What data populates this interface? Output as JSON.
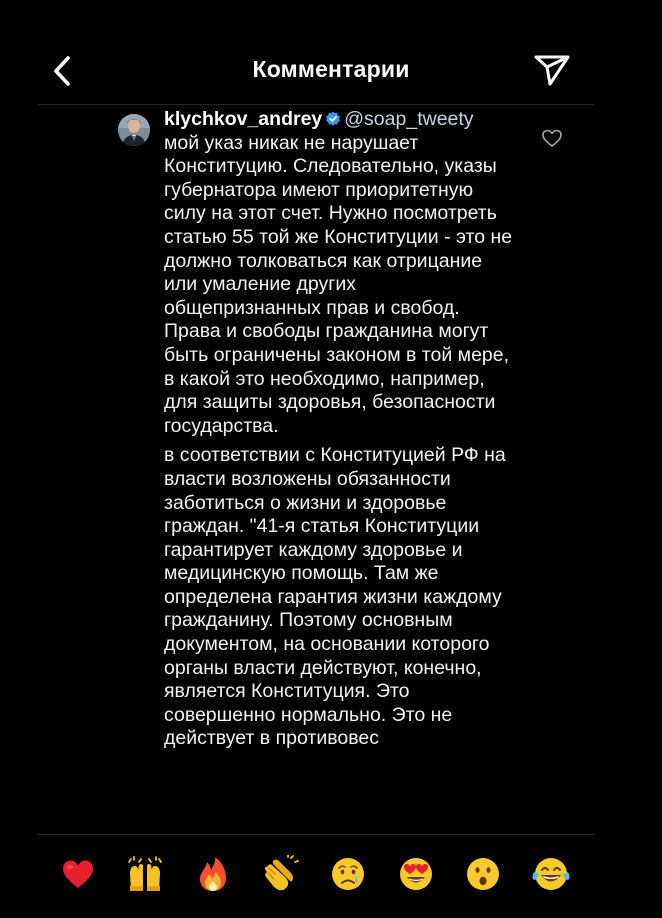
{
  "header": {
    "title": "Комментарии",
    "back_icon": "chevron-left-icon",
    "share_icon": "direct-send-icon"
  },
  "comment": {
    "username": "klychkov_andrey",
    "verified": true,
    "mention": "@soap_tweety",
    "paragraph_1": "мой указ никак не нарушает Конституцию. Следовательно, указы губернатора имеют приоритетную силу на этот счет. Нужно посмотреть статью 55 той же Конституции - это не должно толковаться как отрицание или умаление других общепризнанных прав и свобод. Права и свободы гражданина могут быть ограничены законом в той мере, в какой это необходимо, например, для защиты здоровья, безопасности государства.",
    "paragraph_2": "в соответствии с Конституцией РФ на власти возложены обязанности заботиться о жизни и здоровье граждан. \"41-я статья Конституции гарантирует каждому здоровье и медицинскую помощь. Там же определена гарантия жизни каждому гражданину. Поэтому основным документом, на основании которого органы власти действуют, конечно, является Конституция. Это совершенно нормально. Это не действует в противовес",
    "like_icon": "heart-outline-icon"
  },
  "reactions": [
    {
      "name": "red-heart",
      "emoji": "❤️"
    },
    {
      "name": "raising-hands",
      "emoji": "🙌"
    },
    {
      "name": "fire",
      "emoji": "🔥"
    },
    {
      "name": "clapping-hands",
      "emoji": "👏"
    },
    {
      "name": "crying-face",
      "emoji": "😢"
    },
    {
      "name": "heart-eyes",
      "emoji": "😍"
    },
    {
      "name": "surprised-face",
      "emoji": "😮"
    },
    {
      "name": "tears-of-joy",
      "emoji": "😂"
    }
  ],
  "colors": {
    "background": "#000000",
    "text": "#f2f2f2",
    "verified_badge": "#3897f0",
    "divider": "#262626"
  }
}
